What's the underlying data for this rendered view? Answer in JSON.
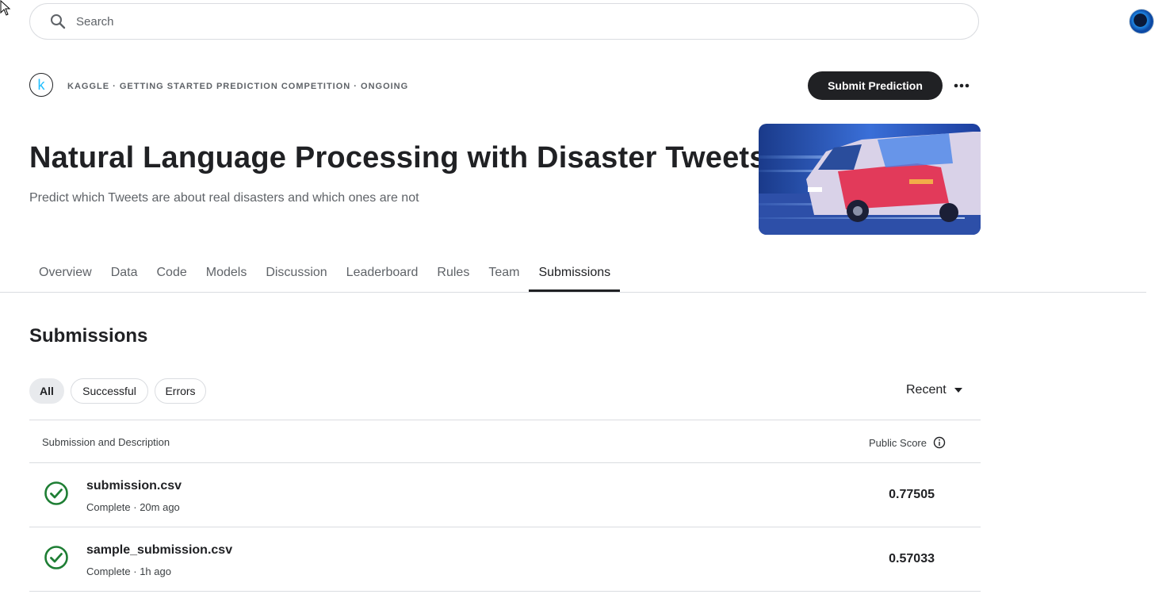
{
  "search": {
    "placeholder": "Search"
  },
  "header": {
    "kicker": "Kaggle · Getting Started Prediction Competition · Ongoing",
    "logo_letter": "k",
    "submit_label": "Submit Prediction",
    "title": "Natural Language Processing with Disaster Tweets",
    "subtitle": "Predict which Tweets are about real disasters and which ones are not"
  },
  "tabs": [
    {
      "label": "Overview"
    },
    {
      "label": "Data"
    },
    {
      "label": "Code"
    },
    {
      "label": "Models"
    },
    {
      "label": "Discussion"
    },
    {
      "label": "Leaderboard"
    },
    {
      "label": "Rules"
    },
    {
      "label": "Team"
    },
    {
      "label": "Submissions",
      "active": true
    }
  ],
  "section_title": "Submissions",
  "filters": [
    {
      "label": "All",
      "active": true
    },
    {
      "label": "Successful"
    },
    {
      "label": "Errors"
    }
  ],
  "sort": {
    "label": "Recent"
  },
  "table": {
    "col_submission": "Submission and Description",
    "col_score": "Public Score",
    "rows": [
      {
        "file": "submission.csv",
        "meta": "Complete · 20m ago",
        "score": "0.77505"
      },
      {
        "file": "sample_submission.csv",
        "meta": "Complete · 1h ago",
        "score": "0.57033"
      }
    ]
  },
  "colors": {
    "accent": "#20beff",
    "primary_button": "#202124",
    "success": "#1e7e34"
  },
  "icons": [
    "search-icon",
    "avatar",
    "kaggle-logo",
    "more-icon",
    "info-icon",
    "check-circle-icon",
    "caret-down-icon",
    "cursor-icon"
  ]
}
